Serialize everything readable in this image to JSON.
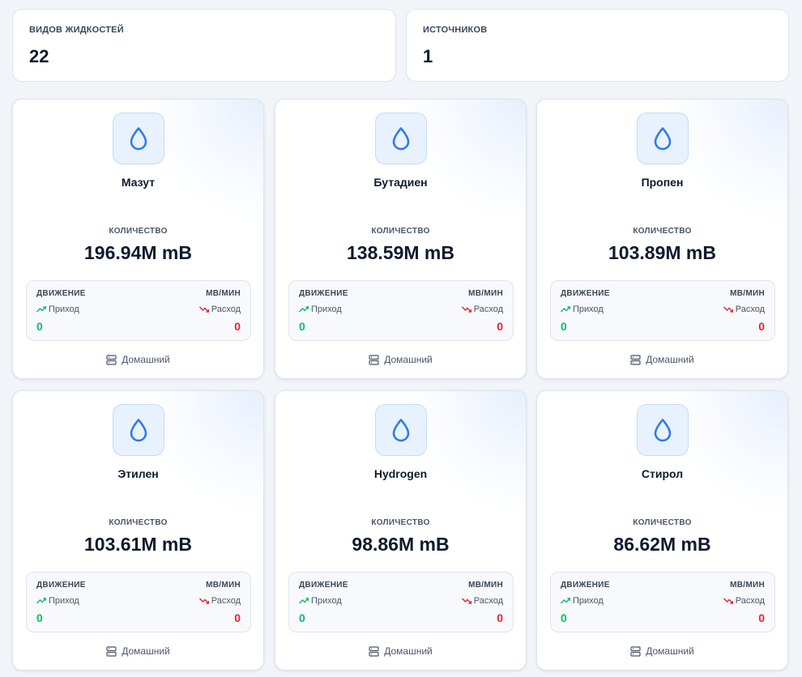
{
  "stats": [
    {
      "label": "ВИДОВ ЖИДКОСТЕЙ",
      "value": "22"
    },
    {
      "label": "ИСТОЧНИКОВ",
      "value": "1"
    }
  ],
  "colors": {
    "accent": "#2f7bea",
    "income": "#12b76a",
    "expense": "#e5242f"
  },
  "card_labels": {
    "quantity": "КОЛИЧЕСТВО",
    "movement": "ДВИЖЕНИЕ",
    "rate_unit": "МВ/МИН",
    "income": "Приход",
    "expense": "Расход",
    "icon": "droplet-icon",
    "source_icon": "server-icon",
    "income_icon": "trend-up-icon",
    "expense_icon": "trend-down-icon"
  },
  "fluids": [
    {
      "name": "Мазут",
      "quantity": "196.94M mB",
      "income": "0",
      "expense": "0",
      "source": "Домашний"
    },
    {
      "name": "Бутадиен",
      "quantity": "138.59M mB",
      "income": "0",
      "expense": "0",
      "source": "Домашний"
    },
    {
      "name": "Пропен",
      "quantity": "103.89M mB",
      "income": "0",
      "expense": "0",
      "source": "Домашний"
    },
    {
      "name": "Этилен",
      "quantity": "103.61M mB",
      "income": "0",
      "expense": "0",
      "source": "Домашний"
    },
    {
      "name": "Hydrogen",
      "quantity": "98.86M mB",
      "income": "0",
      "expense": "0",
      "source": "Домашний"
    },
    {
      "name": "Стирол",
      "quantity": "86.62M mB",
      "income": "0",
      "expense": "0",
      "source": "Домашний"
    }
  ]
}
